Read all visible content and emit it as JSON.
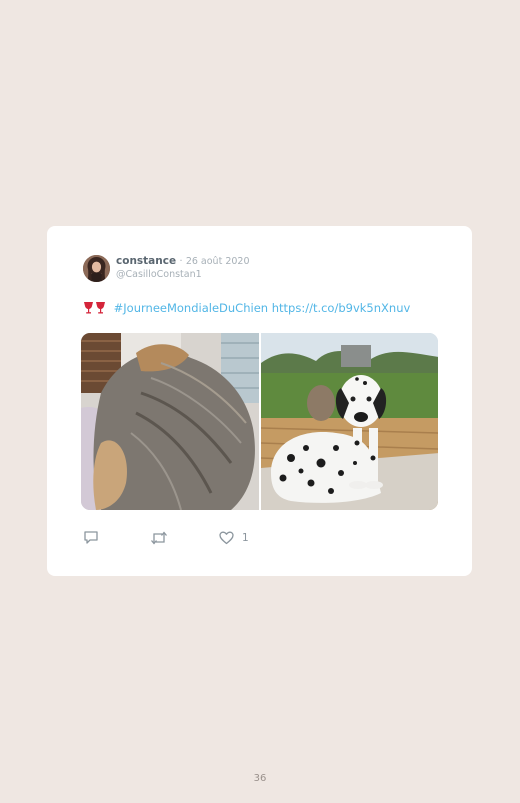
{
  "tweet": {
    "author_name": "constance",
    "separator": "·",
    "date": "26 août 2020",
    "handle": "@CasilloConstan1",
    "emoji": "clinking-glasses-emoji",
    "hashtag": "#JourneeMondialeDuChien",
    "link": "https://t.co/b9vk5nXnuv",
    "media": [
      {
        "name": "sleeping-dog-photo"
      },
      {
        "name": "dalmatian-photo"
      }
    ],
    "actions": {
      "reply_icon": "reply-icon",
      "retweet_icon": "retweet-icon",
      "like_icon": "heart-icon",
      "like_count": "1"
    }
  },
  "page": {
    "number": "36"
  },
  "colors": {
    "background": "#efe7e2",
    "card": "#ffffff",
    "link": "#52b6e6",
    "author": "#5a6670",
    "muted": "#a7b0b7"
  }
}
